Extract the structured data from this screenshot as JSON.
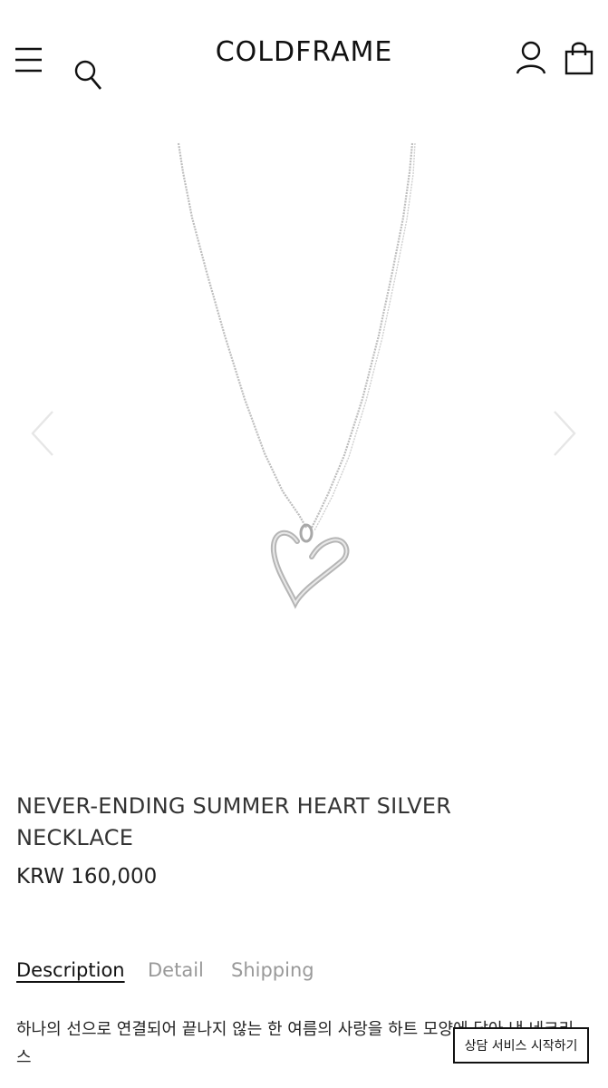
{
  "header": {
    "brand": "COLDFRAME",
    "icons": {
      "menu": "hamburger-menu-icon",
      "search": "search-icon",
      "account": "user-icon",
      "cart": "shopping-bag-icon"
    }
  },
  "gallery": {
    "prev_icon": "chevron-left-icon",
    "next_icon": "chevron-right-icon"
  },
  "product": {
    "title": "NEVER-ENDING SUMMER HEART SILVER NECKLACE",
    "price": "KRW 160,000"
  },
  "tabs": [
    {
      "label": "Description",
      "active": true
    },
    {
      "label": "Detail",
      "active": false
    },
    {
      "label": "Shipping",
      "active": false
    }
  ],
  "description": {
    "text": "하나의 선으로 연결되어 끝나지 않는 한 여름의 사랑을 하트 모양에 담아 낸 네크리스"
  },
  "chat": {
    "label": "상담 서비스 시작하기"
  },
  "colors": {
    "text": "#222222",
    "muted": "#999999",
    "arrow": "#e6e6e6",
    "silver": "#c8c8c8"
  }
}
